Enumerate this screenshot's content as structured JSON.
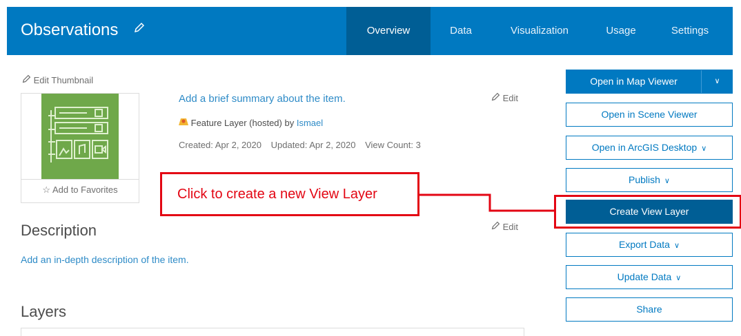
{
  "header": {
    "title": "Observations",
    "tabs": [
      "Overview",
      "Data",
      "Visualization",
      "Usage",
      "Settings"
    ],
    "active_tab": "Overview"
  },
  "thumbnail": {
    "edit_label": "Edit Thumbnail",
    "favorites_label": "Add to Favorites"
  },
  "summary": {
    "text": "Add a brief summary about the item.",
    "edit_label": "Edit",
    "type_text": "Feature Layer (hosted) by ",
    "owner": "Ismael",
    "created": "Created: Apr 2, 2020",
    "updated": "Updated: Apr 2, 2020",
    "views": "View Count: 3"
  },
  "description": {
    "heading": "Description",
    "edit_label": "Edit",
    "placeholder": "Add an in-depth description of the item."
  },
  "layers": {
    "heading": "Layers"
  },
  "actions": {
    "open_map_viewer": "Open in Map Viewer",
    "open_scene_viewer": "Open in Scene Viewer",
    "open_desktop": "Open in ArcGIS Desktop",
    "publish": "Publish",
    "create_view_layer": "Create View Layer",
    "export_data": "Export Data",
    "update_data": "Update Data",
    "share": "Share"
  },
  "annotation": {
    "callout": "Click to create a new View Layer"
  },
  "colors": {
    "brand": "#0079c1",
    "brand_dark": "#005e95",
    "annotation": "#e30613",
    "thumbnail": "#6fa84a"
  }
}
